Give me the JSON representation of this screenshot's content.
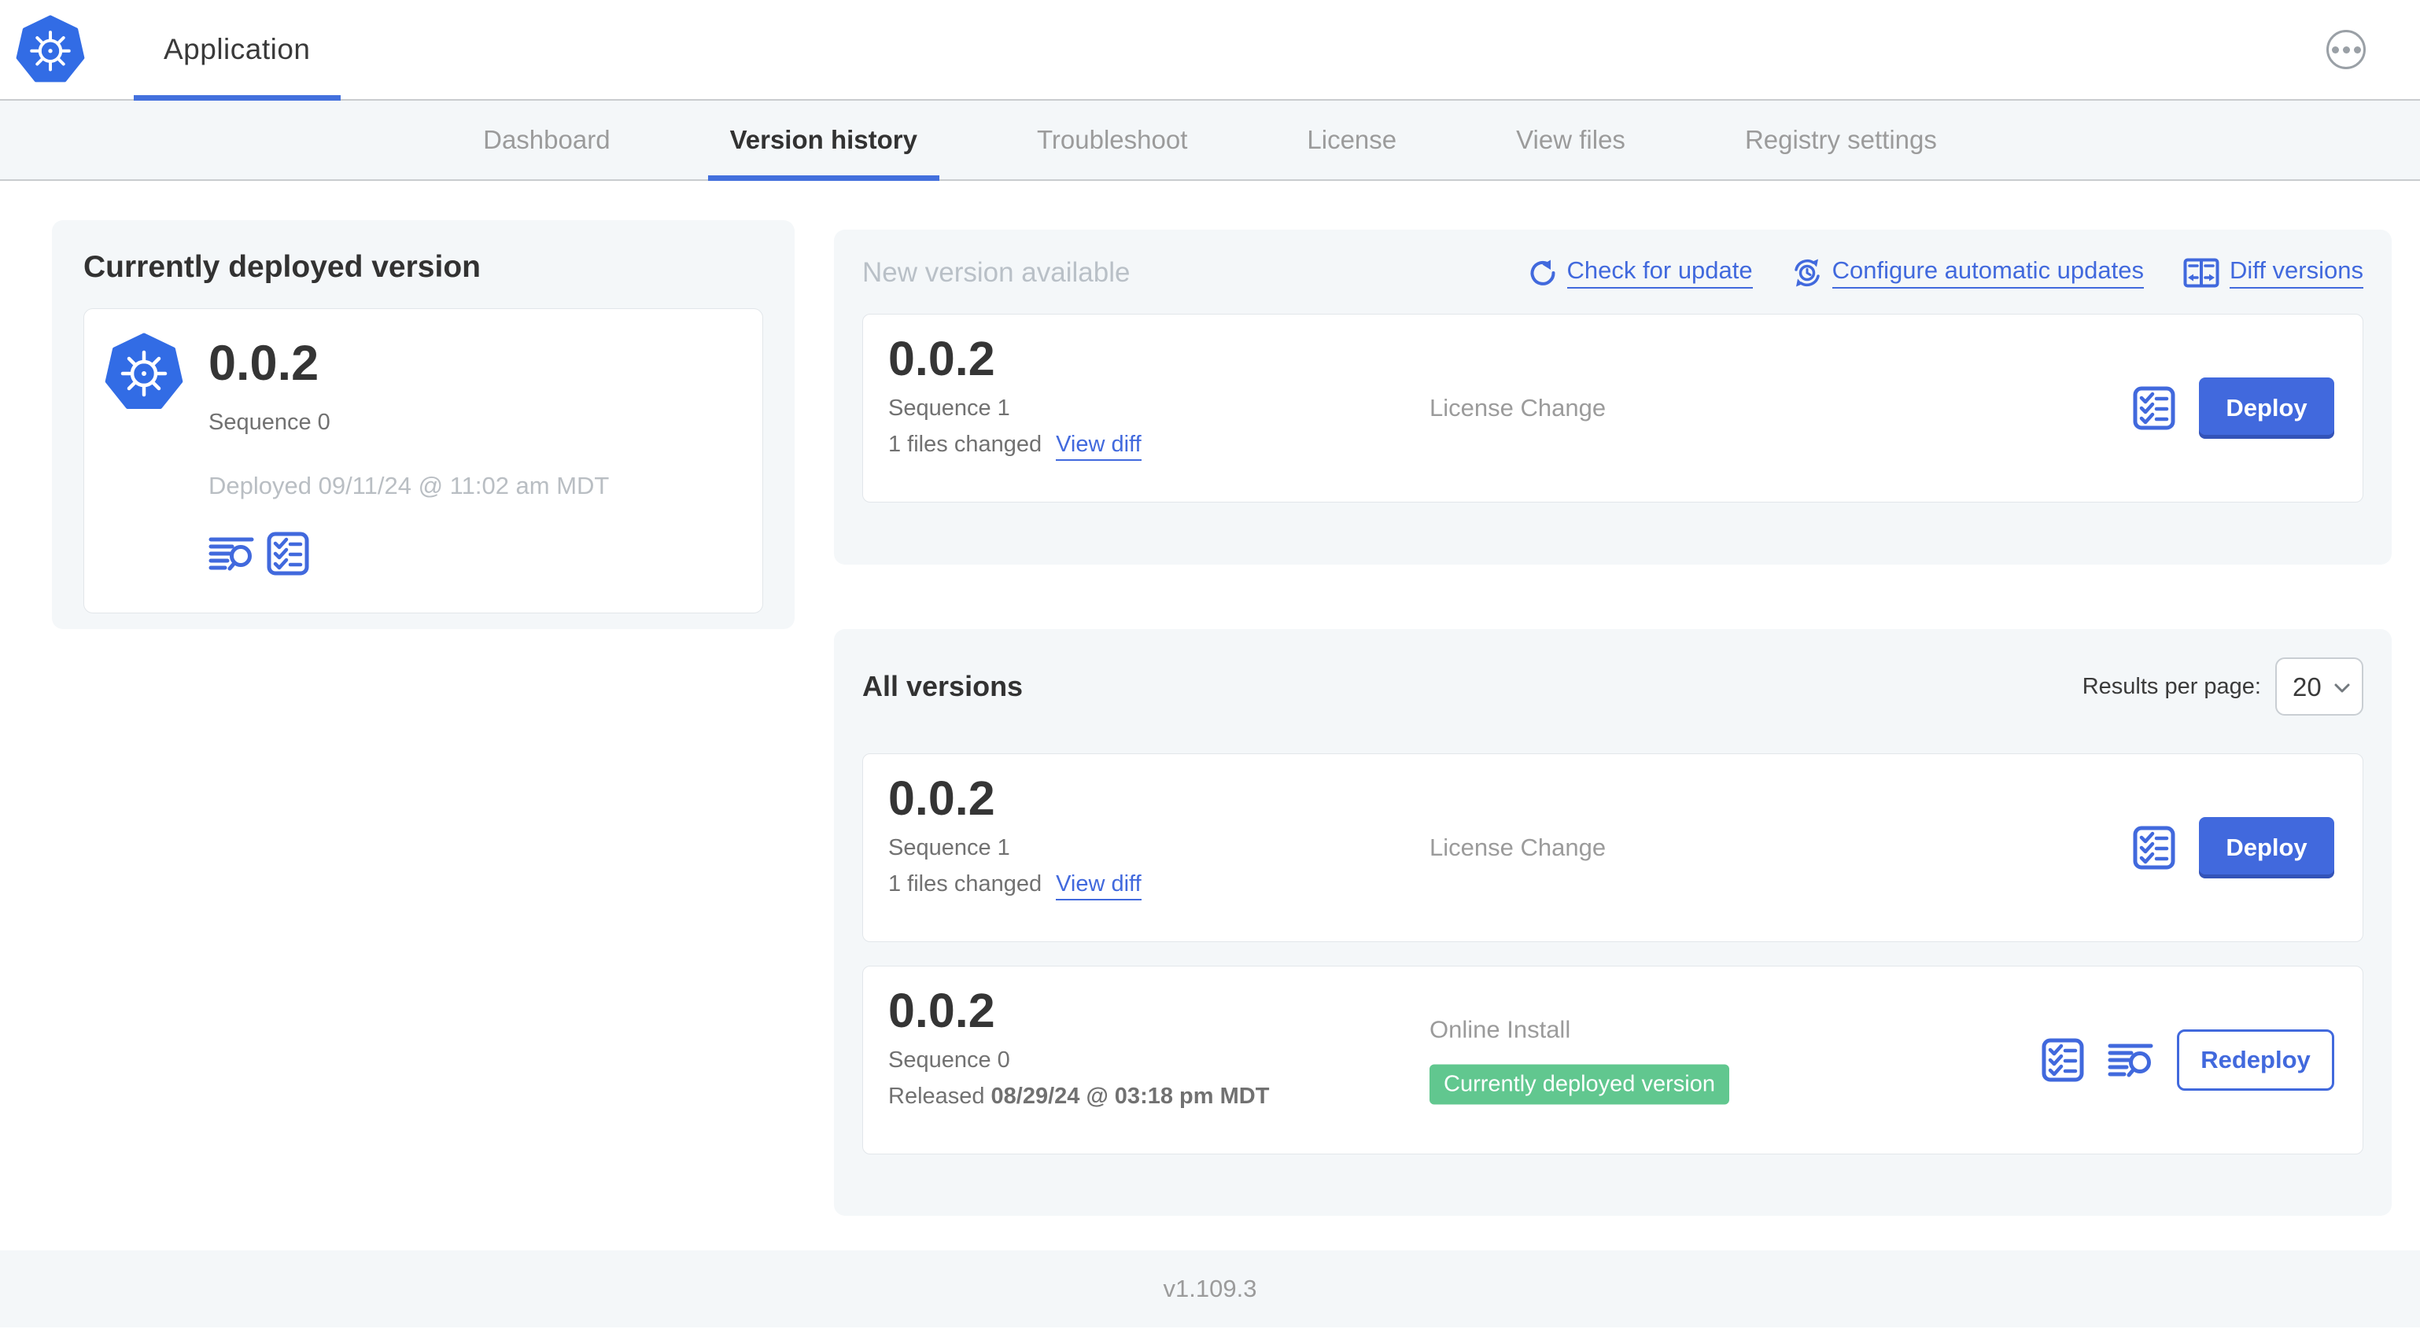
{
  "header": {
    "app_title": "Application"
  },
  "nav_tabs": [
    {
      "label": "Dashboard",
      "active": false
    },
    {
      "label": "Version history",
      "active": true
    },
    {
      "label": "Troubleshoot",
      "active": false
    },
    {
      "label": "License",
      "active": false
    },
    {
      "label": "View files",
      "active": false
    },
    {
      "label": "Registry settings",
      "active": false
    }
  ],
  "current_version": {
    "title": "Currently deployed version",
    "version": "0.0.2",
    "sequence": "Sequence 0",
    "deployed": "Deployed 09/11/24 @ 11:02 am MDT"
  },
  "new_version": {
    "title": "New version available",
    "check_link": "Check for update",
    "configure_link": "Configure automatic updates",
    "diff_link": "Diff versions",
    "row": {
      "version": "0.0.2",
      "sequence": "Sequence 1",
      "files_changed": "1 files changed",
      "view_diff": "View diff",
      "source": "License Change",
      "action": "Deploy"
    }
  },
  "all_versions": {
    "title": "All versions",
    "results_label": "Results per page:",
    "results_value": "20",
    "rows": [
      {
        "version": "0.0.2",
        "sequence": "Sequence 1",
        "files_changed": "1 files changed",
        "view_diff": "View diff",
        "source": "License Change",
        "action": "Deploy"
      },
      {
        "version": "0.0.2",
        "sequence": "Sequence 0",
        "released_prefix": "Released ",
        "released_date": "08/29/24 @ 03:18 pm MDT",
        "source": "Online Install",
        "badge": "Currently deployed version",
        "action": "Redeploy"
      }
    ]
  },
  "footer": {
    "version": "v1.109.3"
  },
  "colors": {
    "primary_blue": "#4169dd",
    "kubernetes_blue": "#326ce5",
    "badge_green": "#61c78f",
    "panel_background": "#f4f7f9",
    "muted_text": "#9b9b9b"
  }
}
